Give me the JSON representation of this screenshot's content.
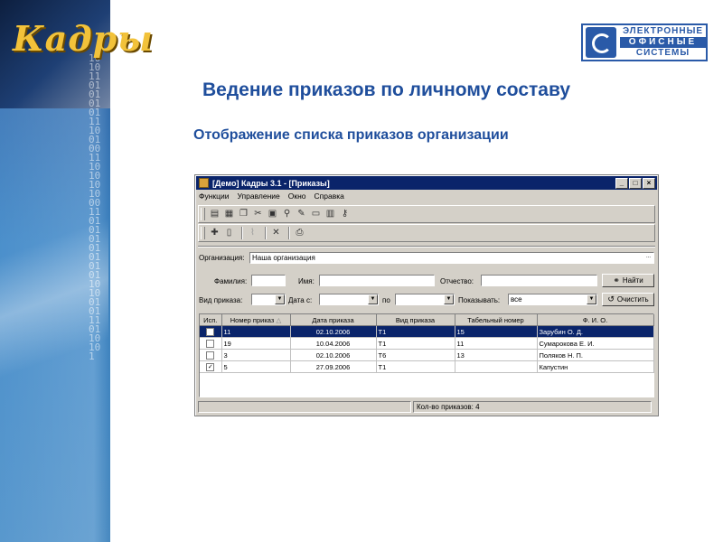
{
  "banner": {
    "logo_text": "Кадры",
    "binary": "1010110101010111100100111010101000110101010101010110100101110110101"
  },
  "company": {
    "line1": "ЭЛЕКТРОННЫЕ",
    "line2": "ОФИСНЫЕ",
    "line3": "СИСТЕМЫ"
  },
  "slide": {
    "title": "Ведение приказов по личному составу",
    "subtitle": "Отображение списка приказов организации"
  },
  "window": {
    "title": "[Демо] Кадры 3.1 - [Приказы]",
    "menu": [
      "Функции",
      "Управление",
      "Окно",
      "Справка"
    ],
    "toolbar1_icons": [
      "card-icon",
      "table-icon",
      "folders-icon",
      "tools-icon",
      "briefcase-icon",
      "search-icon",
      "edit-icon",
      "window-icon",
      "book-icon",
      "key-icon"
    ],
    "toolbar2_icons": [
      "new-doc-icon",
      "doc-icon",
      "attach-icon",
      "delete-icon",
      "print-icon"
    ],
    "filters": {
      "org_label": "Организация:",
      "org_value": "Наша организация",
      "org_more": "...",
      "surname_label": "Фамилия:",
      "surname_value": "",
      "name_label": "Имя:",
      "name_value": "",
      "patronymic_label": "Отчество:",
      "patronymic_value": "",
      "find_label": "Найти",
      "order_type_label": "Вид приказа:",
      "order_type_value": "",
      "date_from_label": "Дата с:",
      "date_from_value": "",
      "date_to_label": "по",
      "date_to_value": "",
      "show_label": "Показывать:",
      "show_value": "все",
      "clear_label": "Очистить"
    },
    "table": {
      "columns": [
        "Исп.",
        "Номер приказ",
        "Дата приказа",
        "Вид приказа",
        "Табельный номер",
        "Ф. И. О."
      ],
      "rows": [
        {
          "checked": false,
          "number": "11",
          "date": "02.10.2006",
          "type": "T1",
          "tab_no": "15",
          "fio": "Зарубин О. Д.",
          "selected": true
        },
        {
          "checked": false,
          "number": "19",
          "date": "10.04.2006",
          "type": "T1",
          "tab_no": "11",
          "fio": "Сумарокова Е. И.",
          "selected": false
        },
        {
          "checked": false,
          "number": "3",
          "date": "02.10.2006",
          "type": "T6",
          "tab_no": "13",
          "fio": "Поляков Н. П.",
          "selected": false
        },
        {
          "checked": true,
          "number": "5",
          "date": "27.09.2006",
          "type": "T1",
          "tab_no": "",
          "fio": "Капустин",
          "selected": false
        }
      ]
    },
    "status": {
      "count_text": "Кол-во приказов: 4"
    }
  },
  "colors": {
    "title_blue": "#1f4e9c",
    "selection": "#0a246a",
    "window_face": "#d4d0c8"
  }
}
